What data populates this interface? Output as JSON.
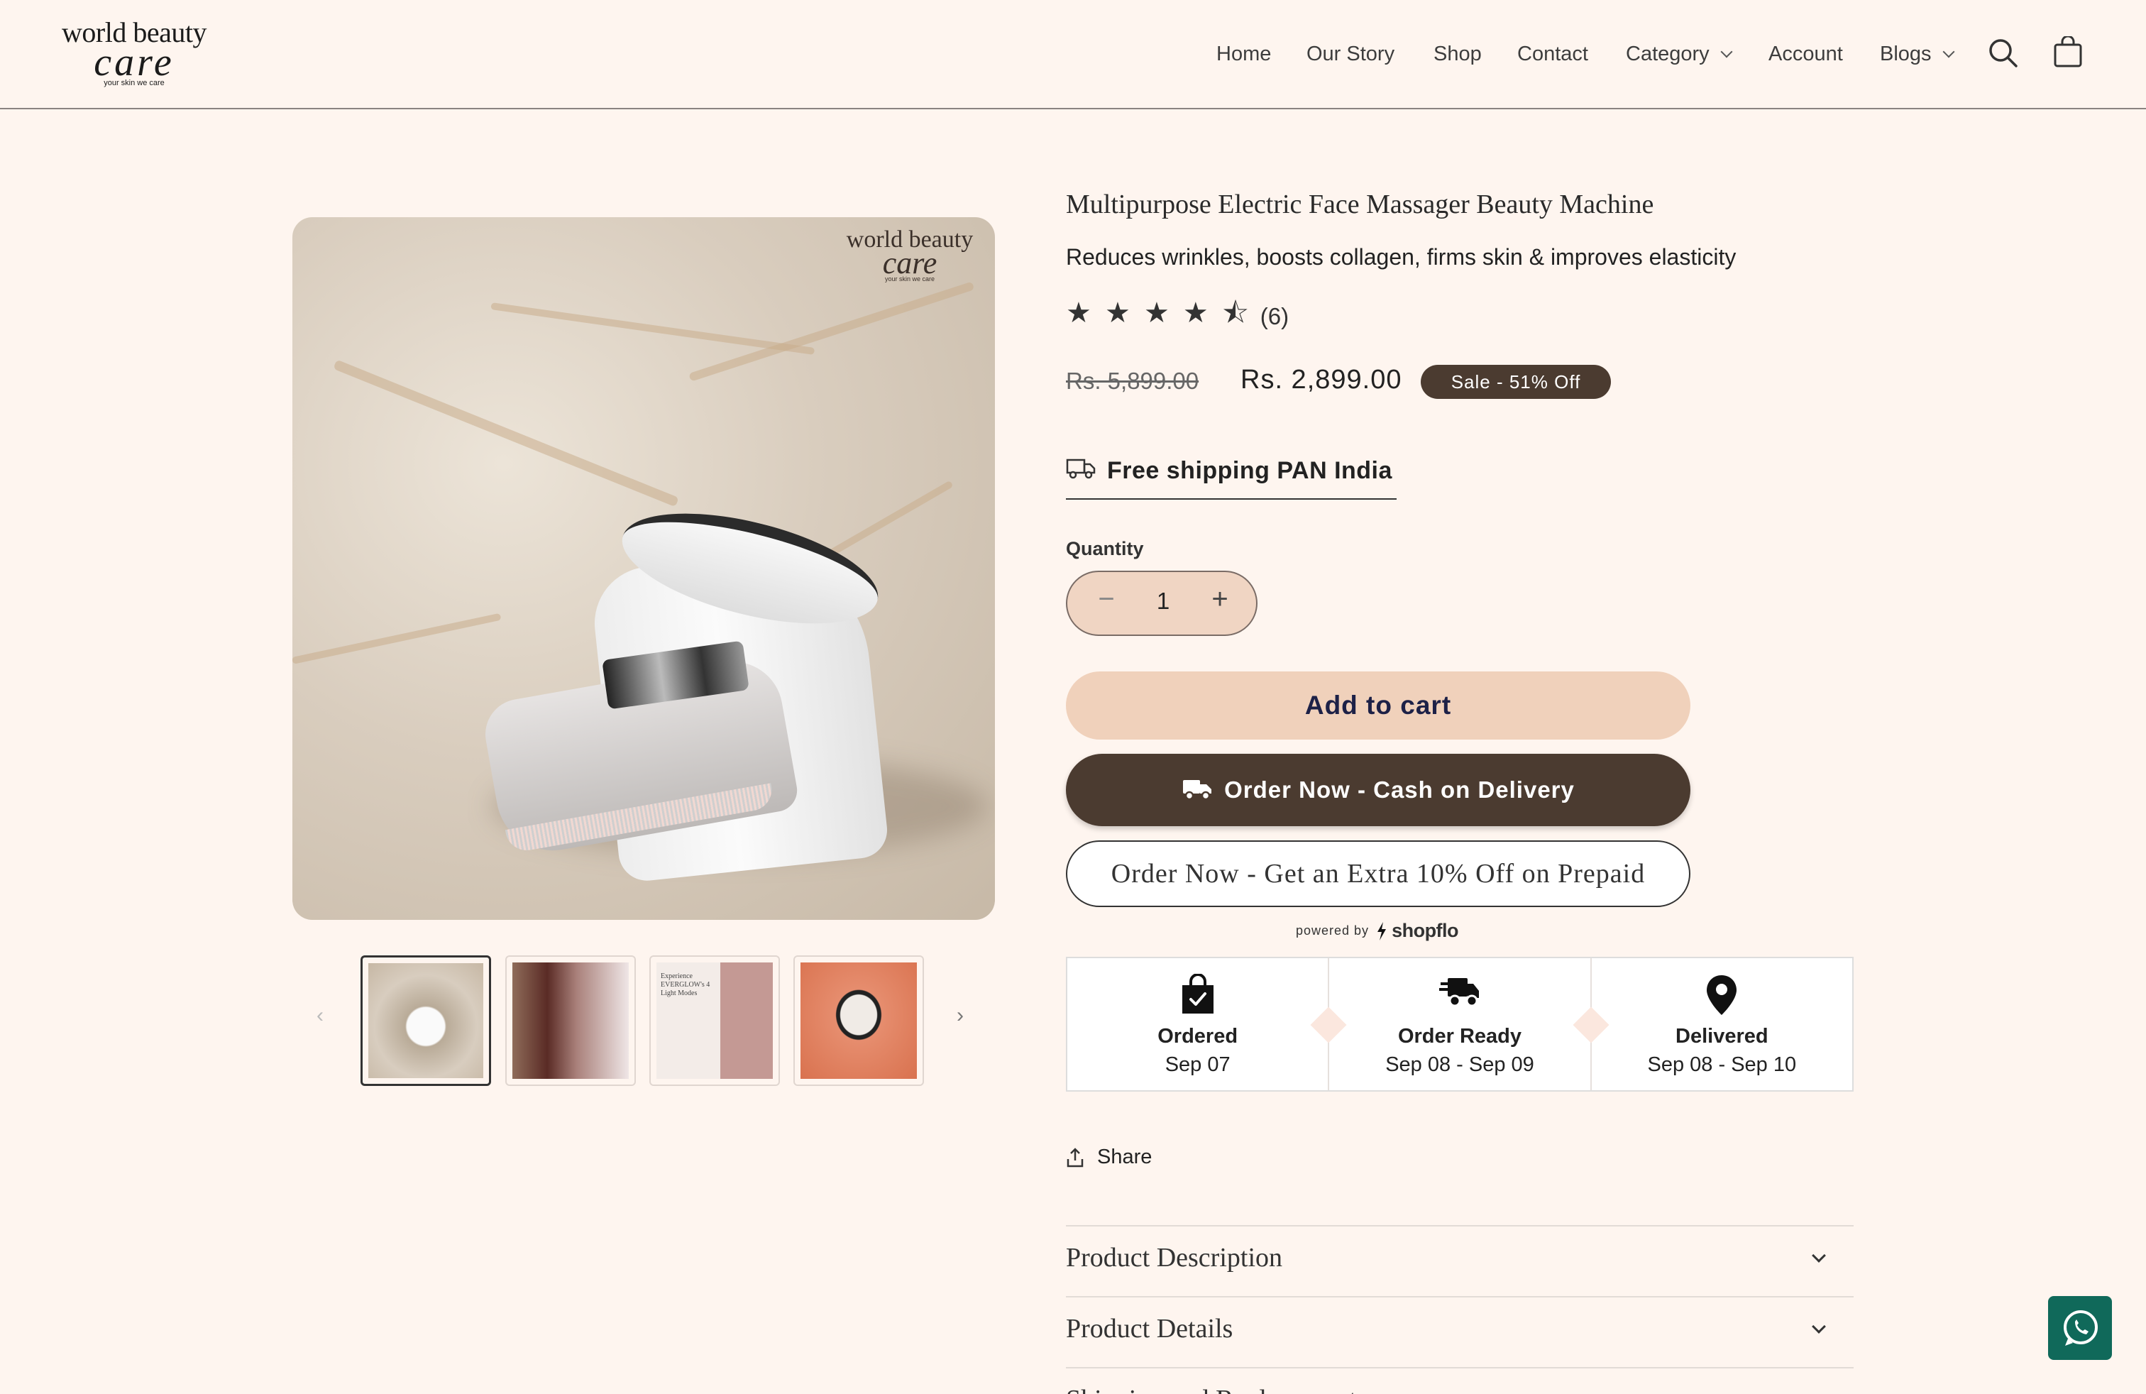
{
  "header": {
    "logo": {
      "line1": "world beauty",
      "line2": "care",
      "tagline": "your skin we care"
    },
    "nav": [
      "Home",
      "Our Story",
      "Shop",
      "Contact",
      "Category",
      "Account",
      "Blogs"
    ],
    "icons": {
      "search": "search-icon",
      "cart": "cart-icon"
    }
  },
  "gallery": {
    "watermark": {
      "line1": "world beauty",
      "line2": "care",
      "tagline": "your skin we care"
    },
    "thumb3_text": "Experience EVERGLOW's 4 Light Modes",
    "thumb_count": 4,
    "active_thumb": 1
  },
  "product": {
    "title": "Multipurpose Electric Face Massager Beauty Machine",
    "subtitle": "Reduces wrinkles, boosts collagen, firms skin & improves elasticity",
    "rating": 4.5,
    "stars": "★ ★ ★ ★ ⯪",
    "review_count": "(6)",
    "price_old": "Rs. 5,899.00",
    "price_new": "Rs. 2,899.00",
    "sale_badge": "Sale - 51% Off",
    "shipping": "Free shipping PAN India",
    "quantity_label": "Quantity",
    "quantity": "1",
    "qty_minus": "−",
    "qty_plus": "+"
  },
  "buttons": {
    "add_to_cart": "Add to cart",
    "cod": "Order Now - Cash on Delivery",
    "prepaid": "Order Now - Get an Extra 10% Off on Prepaid",
    "powered_by": "powered by",
    "powered_brand": "shopflo"
  },
  "timeline": [
    {
      "label": "Ordered",
      "date": "Sep 07",
      "icon": "shopping-bag-check-icon"
    },
    {
      "label": "Order Ready",
      "date": "Sep 08 - Sep 09",
      "icon": "delivery-truck-icon"
    },
    {
      "label": "Delivered",
      "date": "Sep 08 - Sep 10",
      "icon": "location-pin-icon"
    }
  ],
  "share": "Share",
  "accordions": [
    "Product Description",
    "Product Details",
    "Shipping and Replacement"
  ],
  "colors": {
    "background": "#fef5ef",
    "brown": "#4b3b30",
    "peach": "#f0d1bb",
    "whatsapp": "#10695a"
  }
}
